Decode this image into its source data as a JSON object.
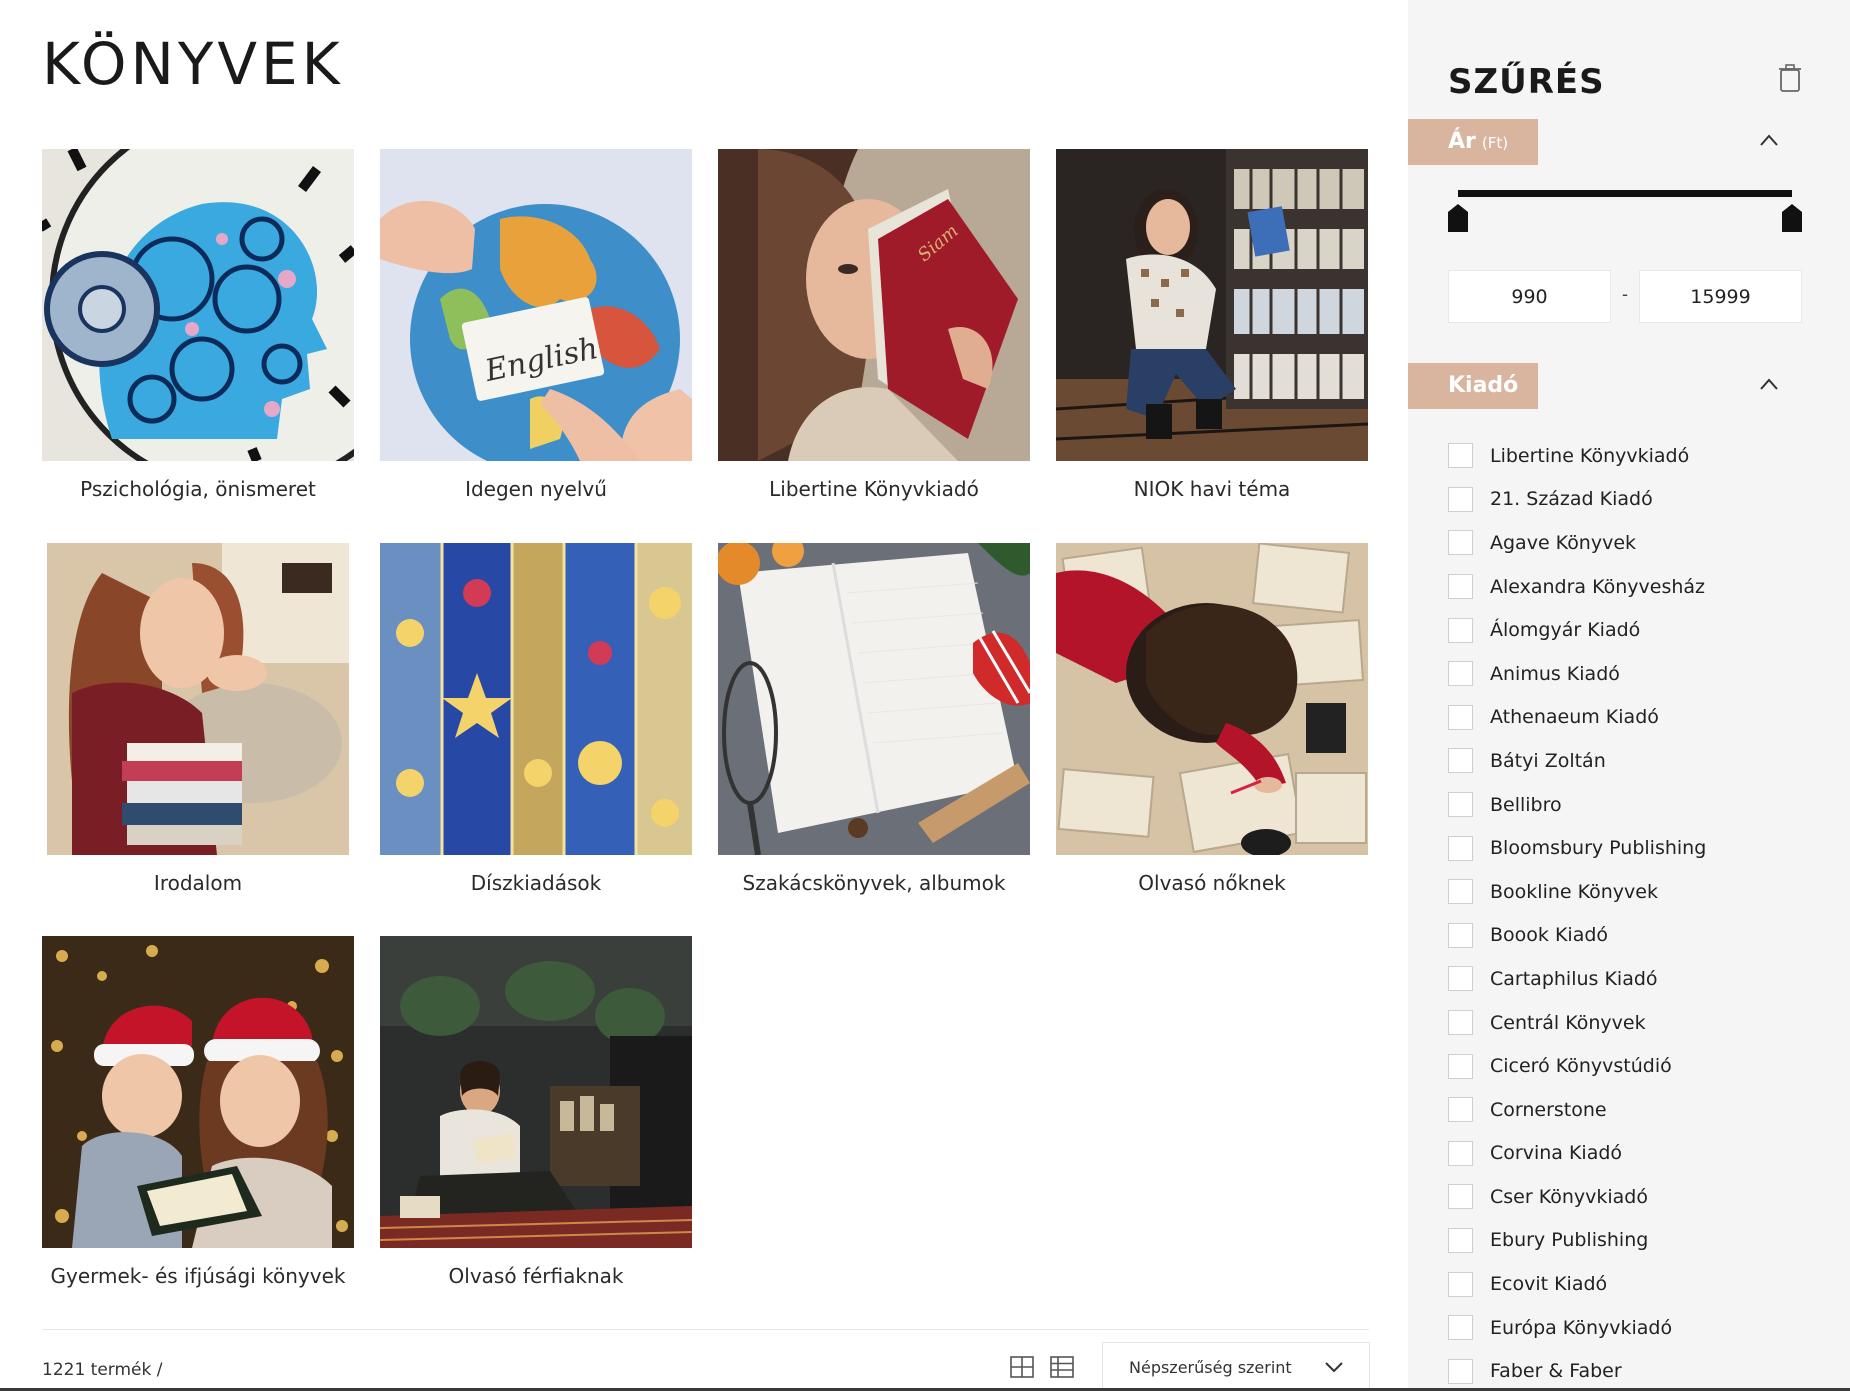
{
  "page": {
    "title": "KÖNYVEK"
  },
  "categories": [
    {
      "label": "Pszichológia, önismeret"
    },
    {
      "label": "Idegen nyelvű"
    },
    {
      "label": "Libertine Könyvkiadó"
    },
    {
      "label": "NIOK havi téma"
    },
    {
      "label": "Irodalom"
    },
    {
      "label": "Díszkiadások"
    },
    {
      "label": "Szakácskönyvek, albumok"
    },
    {
      "label": "Olvasó nőknek"
    },
    {
      "label": "Gyermek- és ifjúsági könyvek"
    },
    {
      "label": "Olvasó férfiaknak"
    }
  ],
  "footer": {
    "count": "1221 termék /",
    "sort_label": "Népszerűség szerint"
  },
  "sidebar": {
    "title": "SZŰRÉS",
    "price": {
      "label": "Ár",
      "unit": "(Ft)",
      "min": "990",
      "max": "15999",
      "dash": "-"
    },
    "publisher": {
      "label": "Kiadó",
      "items": [
        "Libertine Könyvkiadó",
        "21. Század Kiadó",
        "Agave Könyvek",
        "Alexandra Könyvesház",
        "Álomgyár Kiadó",
        "Animus Kiadó",
        "Athenaeum Kiadó",
        "Bátyi Zoltán",
        "Bellibro",
        "Bloomsbury Publishing",
        "Bookline Könyvek",
        "Boook Kiadó",
        "Cartaphilus Kiadó",
        "Centrál Könyvek",
        "Ciceró Könyvstúdió",
        "Cornerstone",
        "Corvina Kiadó",
        "Cser Könyvkiadó",
        "Ebury Publishing",
        "Ecovit Kiadó",
        "Európa Könyvkiadó",
        "Faber & Faber"
      ]
    }
  },
  "colors": {
    "accent": "#d9b49f",
    "slider": "#111111"
  }
}
